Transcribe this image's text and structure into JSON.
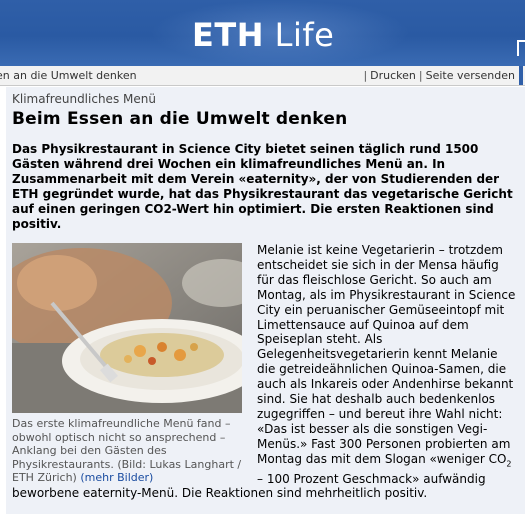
{
  "header": {
    "logo_bold": "ETH",
    "logo_light": "Life"
  },
  "toolbar": {
    "breadcrumb": "en an die Umwelt denken",
    "print_label": "Drucken",
    "send_label": "Seite versenden"
  },
  "article": {
    "kicker": "Klimafreundliches Menü",
    "title": "Beim Essen an die Umwelt denken",
    "lead": "Das Physikrestaurant in Science City bietet seinen täglich rund 1500 Gästen während drei Wochen ein klimafreundliches Menü an. In Zusammenarbeit mit dem Verein «eaternity», der von Studierenden der ETH gegründet wurde, hat das Physikrestaurant das vegetarische Gericht auf einen geringen CO2-Wert hin optimiert. Die ersten Reaktionen sind positiv.",
    "caption": "Das erste klimafreundliche Menü fand – obwohl optisch nicht so ansprechend – Anklang bei den Gästen des Physikrestaurants. (Bild: Lukas Langhart / ETH Zürich)",
    "caption_link": "(mehr Bilder)",
    "body_a": "Melanie ist keine Vegetarierin – trotzdem entscheidet sie sich in der Mensa häufig für das fleischlose Gericht. So auch am Montag, als im Physikrestaurant in Science City ein peruanischer Gemüseeintopf mit Limettensauce auf Quinoa auf dem Speiseplan steht. Als Gelegenheitsvegetarierin kennt Melanie die getreideähnlichen Quinoa-Samen, die auch als Inkareis oder Andenhirse bekannt sind. Sie hat deshalb auch bedenkenlos zugegriffen – und bereut ihre Wahl nicht: «Das ist besser als die sonstigen Vegi-Menüs.» Fast 300 Personen probierten am Montag das mit dem Slogan «weniger CO",
    "body_sub": "2",
    "body_b": " – 100 Prozent Geschmack» aufwändig",
    "body_c": "beworbene eaternity-Menü. Die Reaktionen sind mehrheitlich positiv."
  }
}
